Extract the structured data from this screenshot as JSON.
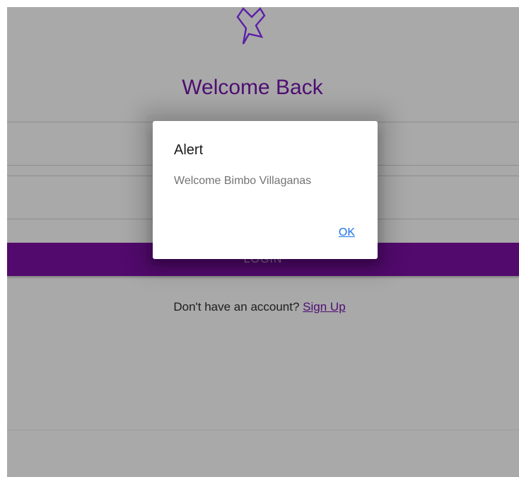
{
  "login_page": {
    "title": "Welcome Back",
    "login_button_label": "LOGIN",
    "signup_prompt": "Don't have an account?",
    "signup_link": "Sign Up"
  },
  "alert_dialog": {
    "title": "Alert",
    "message": "Welcome Bimbo Villaganas",
    "ok_label": "OK"
  },
  "colors": {
    "overlay_background": "#a9a9a9",
    "brand_purple": "#520a6d",
    "title_purple": "#4e0e72",
    "dialog_background": "#ffffff",
    "link_blue": "#1a73e8"
  },
  "icons": {
    "logo": "ribbon-logo-icon"
  }
}
